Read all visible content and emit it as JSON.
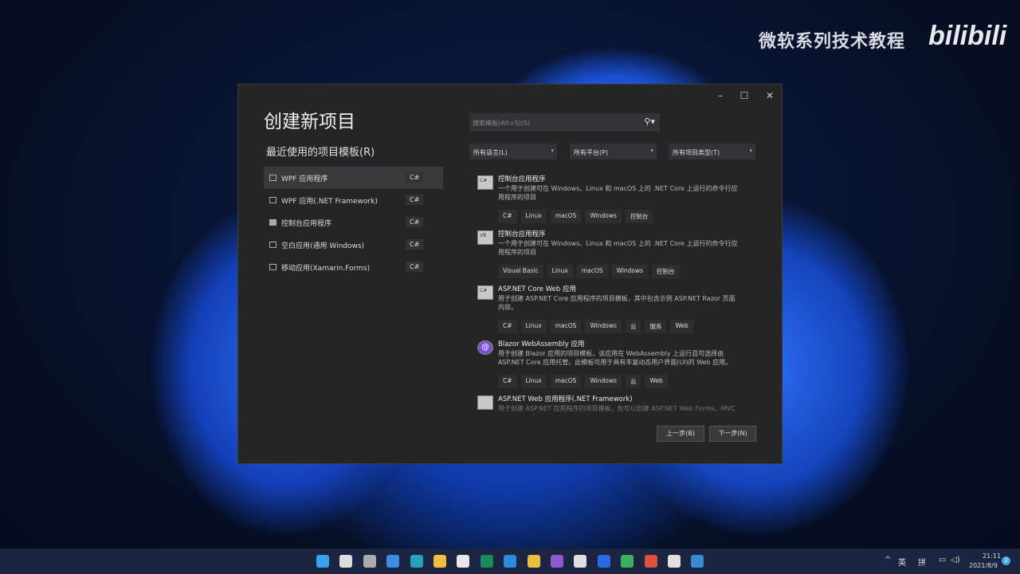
{
  "watermark": {
    "channel": "微软系列技术教程",
    "logo": "bilibili"
  },
  "dialog": {
    "title": "创建新项目",
    "recent_header": "最近使用的项目模板(R)",
    "window_controls": {
      "minimize": "–",
      "maximize": "☐",
      "close": "✕"
    },
    "recent": [
      {
        "label": "WPF 应用程序",
        "lang": "C#",
        "selected": true
      },
      {
        "label": "WPF 应用(.NET Framework)",
        "lang": "C#"
      },
      {
        "label": "控制台应用程序",
        "lang": "C#"
      },
      {
        "label": "空白应用(通用 Windows)",
        "lang": "C#"
      },
      {
        "label": "移动应用(Xamarin.Forms)",
        "lang": "C#"
      }
    ],
    "search": {
      "placeholder": "搜索模板(Alt+S)(S)",
      "icon": "⚲▾"
    },
    "filters": [
      "所有语言(L)",
      "所有平台(P)",
      "所有项目类型(T)"
    ],
    "templates": [
      {
        "name": "控制台应用程序",
        "badge": "C#",
        "desc": "一个用于创建可在 Windows、Linux 和 macOS 上的 .NET Core 上运行的命令行应用程序的项目",
        "tags": [
          "C#",
          "Linux",
          "macOS",
          "Windows",
          "控制台"
        ]
      },
      {
        "name": "控制台应用程序",
        "badge": "VB",
        "desc": "一个用于创建可在 Windows、Linux 和 macOS 上的 .NET Core 上运行的命令行应用程序的项目",
        "tags": [
          "Visual Basic",
          "Linux",
          "macOS",
          "Windows",
          "控制台"
        ]
      },
      {
        "name": "ASP.NET Core Web 应用",
        "badge": "C#",
        "desc": "用于创建 ASP.NET Core 应用程序的项目模板，其中包含示例 ASP.NET Razor 页面内容。",
        "tags": [
          "C#",
          "Linux",
          "macOS",
          "Windows",
          "云",
          "服务",
          "Web"
        ]
      },
      {
        "name": "Blazor WebAssembly 应用",
        "badge": "@",
        "desc": "用于创建 Blazor 应用的项目模板，该应用在 WebAssembly 上运行且可选择由 ASP.NET Core 应用托管。此模板可用于具有丰富动态用户界面(UI)的 Web 应用。",
        "tags": [
          "C#",
          "Linux",
          "macOS",
          "Windows",
          "云",
          "Web"
        ]
      },
      {
        "name": "ASP.NET Web 应用程序(.NET Framework)",
        "badge": "",
        "desc": "用于创建 ASP.NET 应用程序的项目模板。你可以创建 ASP.NET Web Forms、MVC",
        "tags": []
      }
    ],
    "back": "上一步(B)",
    "next": "下一步(N)"
  },
  "tray": {
    "chevron": "^",
    "lang": "英",
    "ime": "拼",
    "time": "21:11",
    "date": "2021/8/9",
    "notifications": "2"
  }
}
